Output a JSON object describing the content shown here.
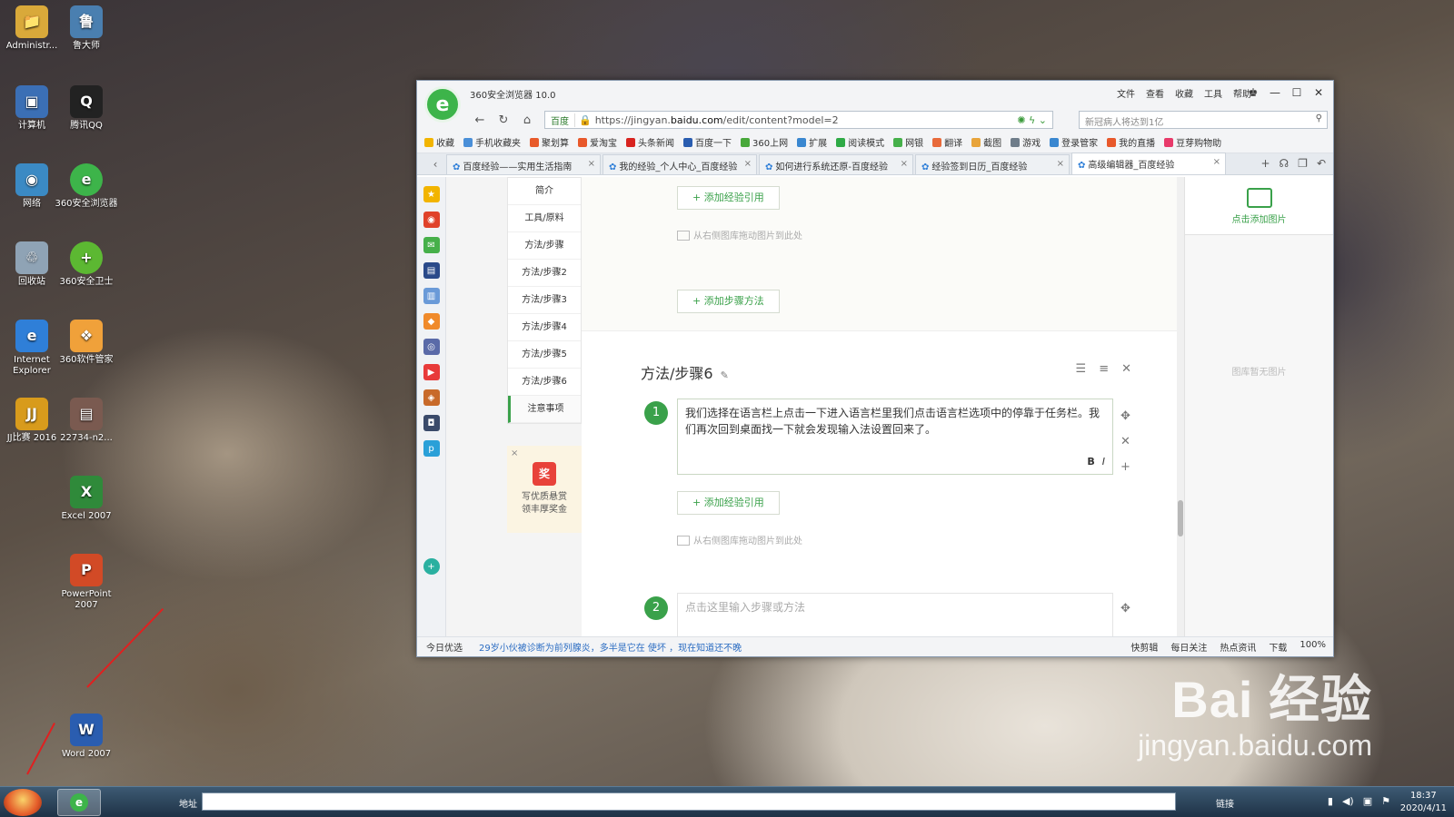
{
  "desktop": {
    "icons": [
      {
        "label": "Administr...",
        "color": "#d9a93a",
        "glyph": "📁"
      },
      {
        "label": "鲁大师",
        "color": "#4a7fb0",
        "glyph": "鲁"
      },
      {
        "label": "计算机",
        "color": "#3b6fb5",
        "glyph": "▣"
      },
      {
        "label": "腾讯QQ",
        "color": "#222222",
        "glyph": "Q"
      },
      {
        "label": "网络",
        "color": "#3b8ac4",
        "glyph": "◉"
      },
      {
        "label": "360安全浏览器",
        "color": "#3db44a",
        "glyph": "e"
      },
      {
        "label": "回收站",
        "color": "#8fa3b5",
        "glyph": "♲"
      },
      {
        "label": "360安全卫士",
        "color": "#5cb832",
        "glyph": "+"
      },
      {
        "label": "Internet Explorer",
        "color": "#2f7fd8",
        "glyph": "e"
      },
      {
        "label": "360软件管家",
        "color": "#f0a13a",
        "glyph": "❖"
      },
      {
        "label": "JJ比赛 2016",
        "color": "#d89b1c",
        "glyph": "JJ"
      },
      {
        "label": "22734-n2...",
        "color": "#7a5a50",
        "glyph": "▤"
      },
      {
        "label": "Excel 2007",
        "color": "#2f8a3a",
        "glyph": "X"
      },
      {
        "label": "PowerPoint 2007",
        "color": "#d24a26",
        "glyph": "P"
      },
      {
        "label": "Word 2007",
        "color": "#2a5db0",
        "glyph": "W"
      }
    ]
  },
  "watermark": {
    "brand": "Bai 经验",
    "site": "jingyan.baidu.com"
  },
  "browser": {
    "title": "360安全浏览器 10.0",
    "menus": [
      "文件",
      "查看",
      "收藏",
      "工具",
      "帮助"
    ],
    "address": {
      "site_label": "百度",
      "url_prefix": "https://jingyan.",
      "url_domain": "baidu.com",
      "url_path": "/edit/content?model=2"
    },
    "search_placeholder": "新冠病人将达到1亿",
    "favorites": [
      "收藏",
      "手机收藏夹",
      "聚划算",
      "爱淘宝",
      "头条新闻",
      "百度一下",
      "360上网",
      "扩展",
      "阅读模式",
      "网银",
      "翻译",
      "截图",
      "游戏",
      "登录管家",
      "我的直播",
      "豆芽购物助"
    ],
    "tabs": [
      {
        "label": "百度经验——实用生活指南"
      },
      {
        "label": "我的经验_个人中心_百度经验"
      },
      {
        "label": "如何进行系统还原-百度经验"
      },
      {
        "label": "经验签到日历_百度经验"
      },
      {
        "label": "高级编辑器_百度经验"
      }
    ],
    "outline": [
      "简介",
      "工具/原料",
      "方法/步骤",
      "方法/步骤2",
      "方法/步骤3",
      "方法/步骤4",
      "方法/步骤5",
      "方法/步骤6",
      "注意事项"
    ],
    "promo": {
      "x": "×",
      "gift": "奖",
      "line1": "写优质悬赏",
      "line2": "领丰厚奖金"
    },
    "editor": {
      "add_ref": "+ 添加经验引用",
      "drag_hint": "从右侧图库拖动图片到此处",
      "add_method": "+ 添加步骤方法",
      "section_title": "方法/步骤6",
      "step1_num": "1",
      "step1_text": "我们选择在语言栏上点击一下进入语言栏里我们点击语言栏选项中的停靠于任务栏。我们再次回到桌面找一下就会发现输入法设置回来了。",
      "step2_num": "2",
      "step2_placeholder": "点击这里输入步骤或方法",
      "bold": "B",
      "italic": "I"
    },
    "gallery": {
      "add_label": "点击添加图片",
      "empty": "图库暂无图片"
    },
    "status": {
      "left": "今日优选",
      "news": "29岁小伙被诊断为前列腺炎，多半是它在 使坏 ，现在知道还不晚",
      "items": [
        "快剪辑",
        "每日关注",
        "热点资讯",
        "下载"
      ],
      "zoom": "100%"
    }
  },
  "taskbar": {
    "addr_label": "地址",
    "links_label": "链接",
    "time": "18:37",
    "date": "2020/4/11"
  }
}
